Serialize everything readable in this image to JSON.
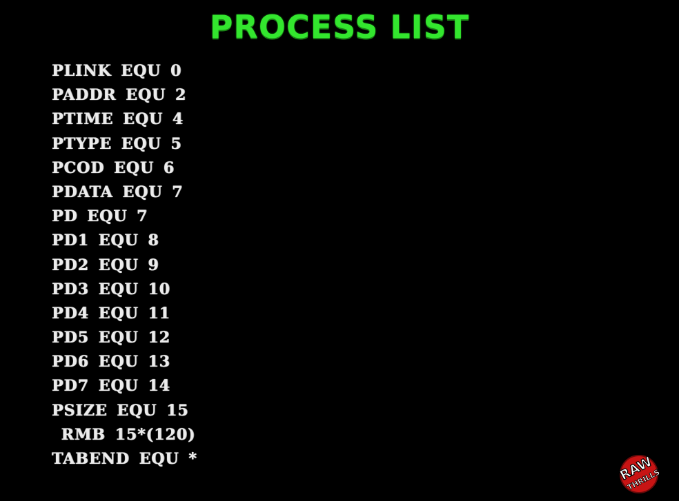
{
  "screen": {
    "title": "PROCESS LIST",
    "title_color": "#33e62e",
    "text_color": "#ececec",
    "background": "#000000"
  },
  "listing": [
    "PLINK EQU 0",
    "PADDR EQU 2",
    "PTIME EQU 4",
    "PTYPE EQU 5",
    "PCOD EQU 6",
    "PDATA EQU 7",
    "PD EQU 7",
    "PD1 EQU 8",
    "PD2 EQU 9",
    "PD3 EQU 10",
    "PD4 EQU 11",
    "PD5 EQU 12",
    "PD6 EQU 13",
    "PD7 EQU 14",
    "PSIZE EQU 15",
    " RMB 15*(120)",
    "TABEND EQU *"
  ],
  "logo": {
    "text": "RAW THRILLS",
    "icon": "raw-thrills-logo-icon"
  }
}
